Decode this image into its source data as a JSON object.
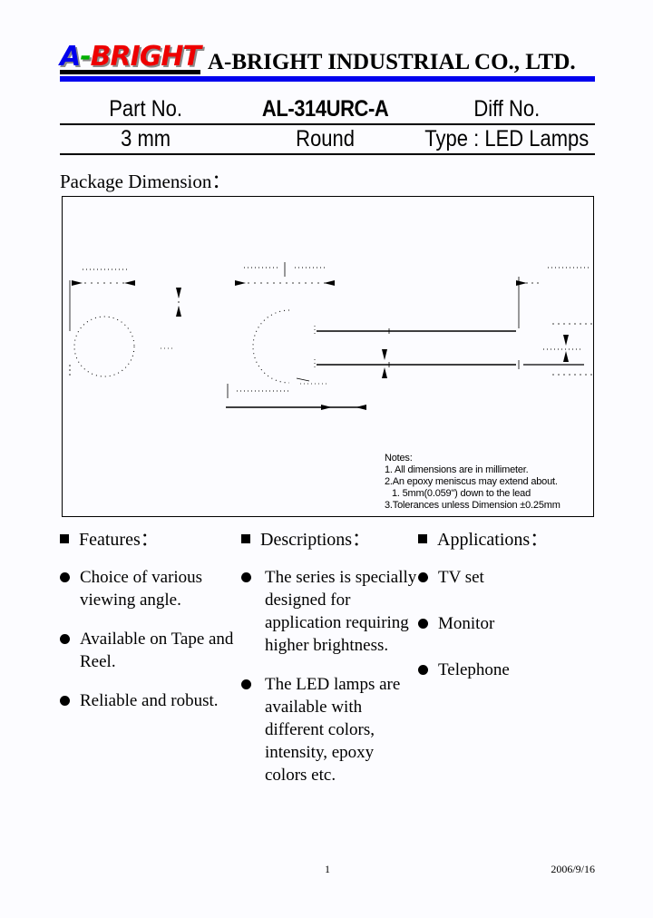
{
  "header": {
    "logo": {
      "letter_a": "A",
      "dash": "-",
      "bright": "BRIGHT",
      "color_a": "#0000ee",
      "color_dash": "#00b000",
      "color_bright": "#ee0000"
    },
    "company_name": "A-BRIGHT INDUSTRIAL CO., LTD.",
    "rule_color": "#0000ee"
  },
  "part_table": {
    "row1": {
      "label_part_no": "Part No.",
      "part_number": "AL-314URC-A",
      "label_diff_no": "Diff No."
    },
    "row2": {
      "size": "3 mm",
      "shape": "Round",
      "type": "Type : LED Lamps"
    }
  },
  "package_dimension": {
    "label": "Package Dimension：",
    "notes": {
      "title": "Notes:",
      "line1": "1. All dimensions are in millimeter.",
      "line2": "2.An epoxy meniscus may extend about.",
      "line3": "1. 5mm(0.059\") down to the lead",
      "line4": "3.Tolerances unless Dimension ±0.25mm"
    }
  },
  "columns": {
    "features": {
      "heading": "Features：",
      "items": [
        "Choice of various viewing angle.",
        "Available on Tape and Reel.",
        "Reliable and robust."
      ]
    },
    "descriptions": {
      "heading": "Descriptions：",
      "items": [
        "The series is specially designed for application requiring higher brightness.",
        "The LED lamps are available with different colors, intensity, epoxy colors etc."
      ]
    },
    "applications": {
      "heading": "Applications：",
      "items": [
        "TV set",
        "Monitor",
        "Telephone"
      ]
    }
  },
  "footer": {
    "page_number": "1",
    "date": "2006/9/16"
  }
}
